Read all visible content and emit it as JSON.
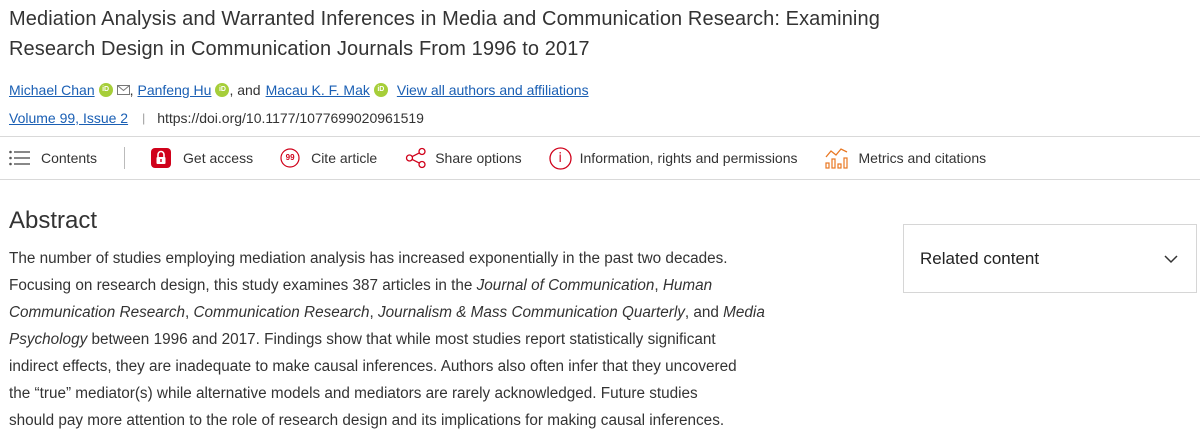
{
  "article": {
    "title_line1": "Mediation Analysis and Warranted Inferences in Media and Communication Research: Examining",
    "title_line2": "Research Design in Communication Journals From 1996 to 2017"
  },
  "authors": {
    "author1": "Michael Chan",
    "comma1": ",",
    "author2": "Panfeng Hu",
    "and_text": ", and",
    "author3": "Macau K. F. Mak",
    "view_all": "View all authors and affiliations",
    "orcid_label": "iD"
  },
  "meta": {
    "volume": "Volume 99, Issue 2",
    "separator": "|",
    "doi": "https://doi.org/10.1177/1077699020961519"
  },
  "toolbar": {
    "contents": "Contents",
    "get_access": "Get access",
    "cite_article": "Cite article",
    "cite_glyph": "99",
    "share_options": "Share options",
    "info_rights": "Information, rights and permissions",
    "info_glyph": "i",
    "metrics": "Metrics and citations"
  },
  "abstract": {
    "heading": "Abstract",
    "l1": "The number of studies employing mediation analysis has increased exponentially in the past two decades.",
    "l2a": "Focusing on research design, this study examines 387 articles in the ",
    "l2b": "Journal of Communication",
    "l2c": ", ",
    "l2d": "Human",
    "l3a": "Communication Research",
    "l3b": ", ",
    "l3c": "Communication Research",
    "l3d": ", ",
    "l3e": "Journalism & Mass Communication Quarterly",
    "l3f": ", and ",
    "l3g": "Media",
    "l4a": "Psychology",
    "l4b": " between 1996 and 2017. Findings show that while most studies report statistically significant",
    "l5": "indirect effects, they are inadequate to make causal inferences. Authors also often infer that they uncovered",
    "l6": "the “true” mediator(s) while alternative models and mediators are rarely acknowledged. Future studies",
    "l7": "should pay more attention to the role of research design and its implications for making causal inferences."
  },
  "sidebar": {
    "related_content": "Related content"
  },
  "colors": {
    "link": "#1a5fb4",
    "orcid": "#a6ce39",
    "lock": "#d0021b",
    "metrics_orange": "#e87722"
  }
}
